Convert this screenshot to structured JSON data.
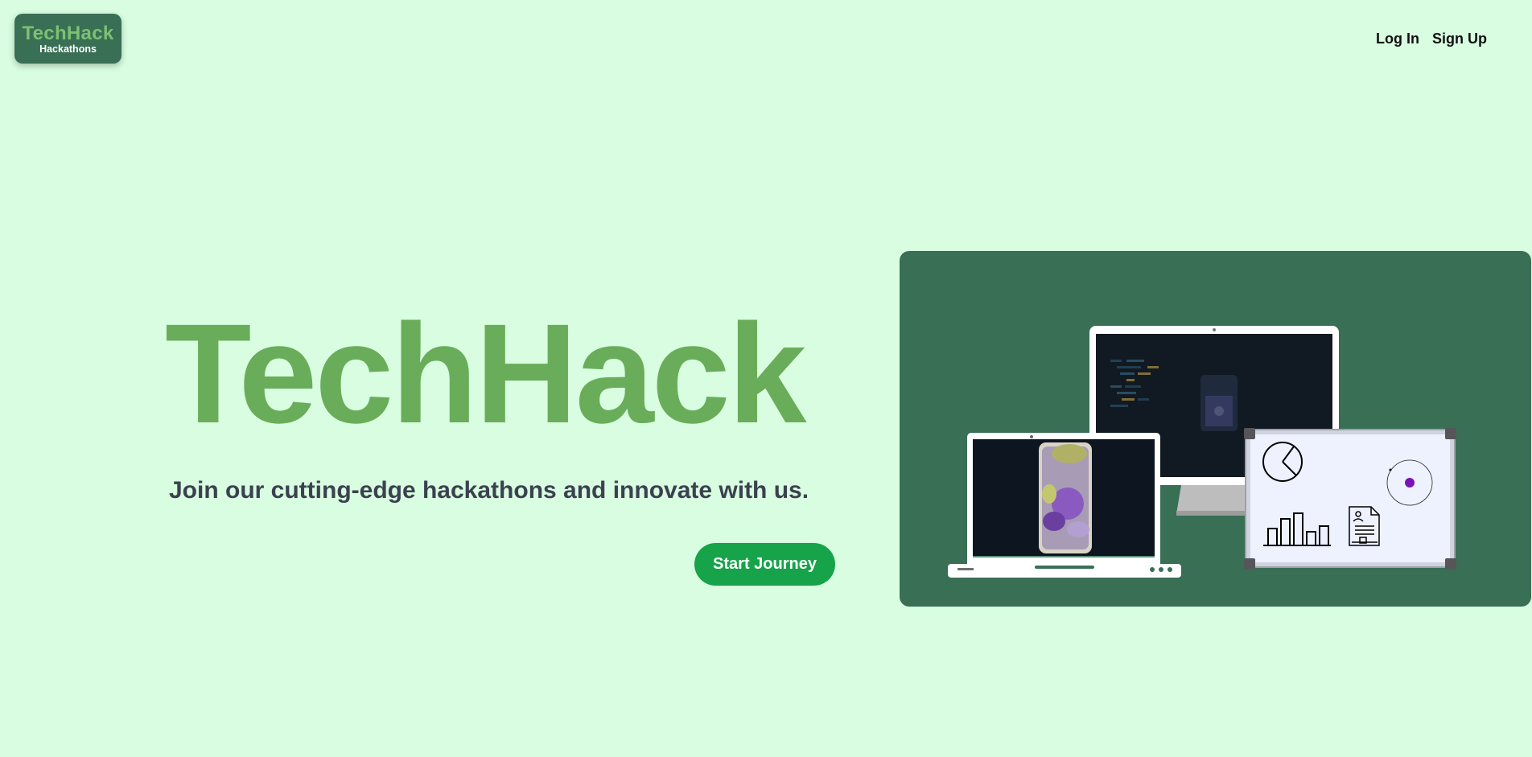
{
  "logo": {
    "title": "TechHack",
    "subtitle": "Hackathons"
  },
  "nav": {
    "login": "Log In",
    "signup": "Sign Up"
  },
  "hero": {
    "title": "TechHack",
    "subtitle": "Join our cutting-edge hackathons and innovate with us.",
    "cta": "Start Journey"
  },
  "colors": {
    "background": "#d8fde0",
    "accent_green": "#69ad5a",
    "panel": "#386f55",
    "button": "#16a34a"
  },
  "illustration": {
    "icons": [
      "monitor-icon",
      "laptop-icon",
      "phone-icon",
      "whiteboard-icon",
      "pie-chart-icon",
      "bar-chart-icon",
      "document-icon",
      "orbit-icon"
    ]
  }
}
